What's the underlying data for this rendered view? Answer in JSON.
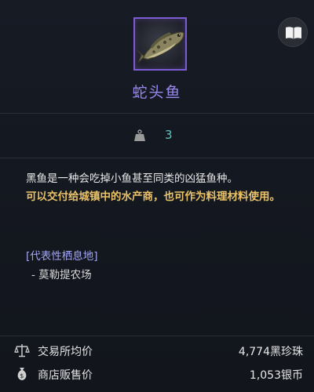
{
  "item": {
    "name": "蛇头鱼",
    "frame_color": "#7d5bd6",
    "icon": "fish-icon"
  },
  "header": {
    "book_icon": "book-icon"
  },
  "weight": {
    "icon": "weight-icon",
    "value": "3"
  },
  "description": {
    "line1": "黑鱼是一种会吃掉小鱼甚至同类的凶猛鱼种。",
    "highlight": "可以交付给城镇中的水产商，也可作为料理材料使用。",
    "highlight_color": "#e9c26a"
  },
  "habitat": {
    "title": "[代表性栖息地]",
    "items": [
      "- 莫勒提农场"
    ]
  },
  "prices": [
    {
      "icon": "scale-icon",
      "label": "交易所均价",
      "value": "4,774黑珍珠"
    },
    {
      "icon": "money-bag-icon",
      "label": "商店贩售价",
      "value": "1,053银币"
    }
  ]
}
